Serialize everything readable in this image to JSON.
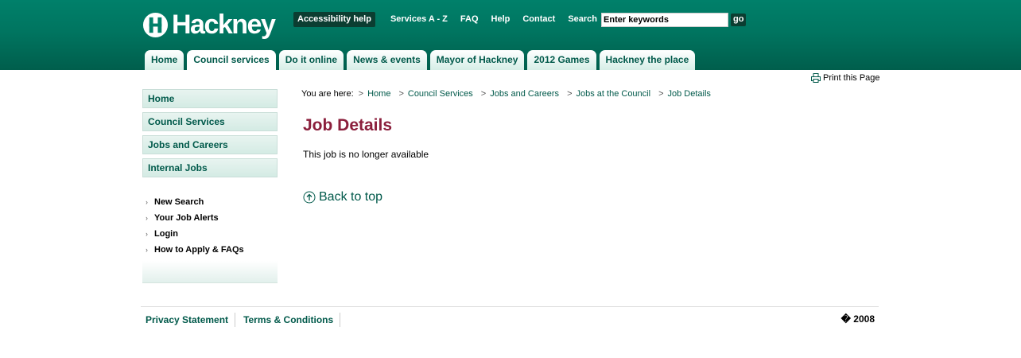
{
  "header": {
    "logo_text": "Hackney",
    "accessibility_label": "Accessibility help",
    "top_links": [
      "Services A - Z",
      "FAQ",
      "Help",
      "Contact"
    ],
    "search_label": "Search",
    "search_value": "Enter keywords",
    "go_label": "go",
    "tabs": [
      {
        "label": "Home",
        "active": false
      },
      {
        "label": "Council services",
        "active": true
      },
      {
        "label": "Do it online",
        "active": false
      },
      {
        "label": "News & events",
        "active": false
      },
      {
        "label": "Mayor of Hackney",
        "active": false
      },
      {
        "label": "2012 Games",
        "active": false
      },
      {
        "label": "Hackney the place",
        "active": false
      }
    ]
  },
  "print_label": "Print this Page",
  "leftnav": {
    "boxes": [
      "Home",
      "Council Services",
      "Jobs and Careers",
      "Internal Jobs"
    ],
    "sub_items": [
      "New Search",
      "Your Job Alerts",
      "Login",
      "How to Apply & FAQs"
    ]
  },
  "breadcrumb": {
    "label": "You are here:",
    "separator": ">",
    "items": [
      "Home",
      "Council Services",
      "Jobs and Careers",
      "Jobs at the Council",
      "Job Details"
    ]
  },
  "main": {
    "title": "Job Details",
    "message": "This job is no longer available",
    "back_to_top": "Back to top"
  },
  "footer": {
    "links": [
      "Privacy Statement",
      "Terms & Conditions"
    ],
    "copyright": "� 2008"
  },
  "colors": {
    "brand_green": "#007560",
    "title_maroon": "#8b1f3c",
    "link_green": "#00594a"
  }
}
